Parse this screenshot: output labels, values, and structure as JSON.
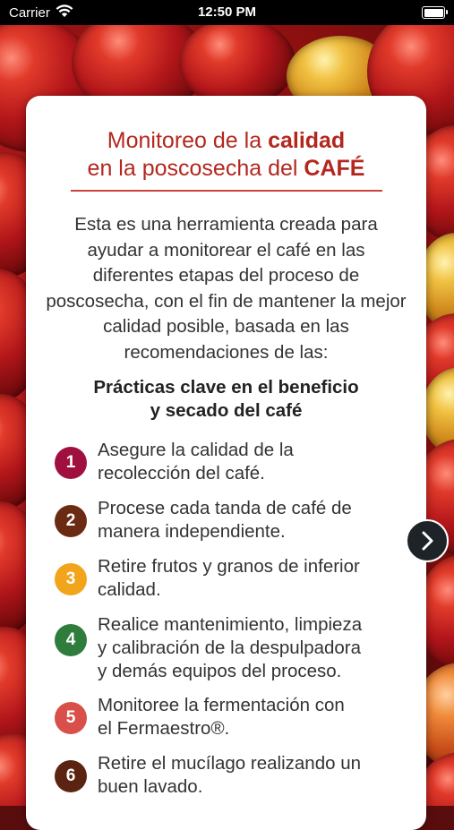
{
  "status_bar": {
    "carrier": "Carrier",
    "time": "12:50 PM",
    "wifi_icon": "wifi-icon",
    "battery_icon": "battery-icon"
  },
  "card": {
    "title_line1_regular": "Monitoreo de la ",
    "title_line1_bold": "calidad",
    "title_line2_regular": "en la poscosecha del ",
    "title_line2_bold": "CAFÉ",
    "intro": "Esta es una herramienta creada para ayudar a monitorear el café en las diferentes etapas del proceso de poscosecha, con el fin de mantener la mejor calidad posible, basada en las recomendaciones de las:",
    "practices_heading_line1": "Prácticas clave en el beneficio",
    "practices_heading_line2": "y secado del café",
    "items": [
      {
        "number": "1",
        "text_line1": "Asegure la calidad de la",
        "text_line2": "recolección del café.",
        "text_line3": "",
        "color": "#a0103f"
      },
      {
        "number": "2",
        "text_line1": "Procese cada tanda de café de",
        "text_line2": "manera independiente.",
        "text_line3": "",
        "color": "#6b2a12"
      },
      {
        "number": "3",
        "text_line1": "Retire frutos y granos de inferior",
        "text_line2": "calidad.",
        "text_line3": "",
        "color": "#f2a51a"
      },
      {
        "number": "4",
        "text_line1": "Realice mantenimiento, limpieza",
        "text_line2": "y calibración de la despulpadora",
        "text_line3": "y demás equipos del proceso.",
        "color": "#2e7d3c"
      },
      {
        "number": "5",
        "text_line1": "Monitoree la fermentación con",
        "text_line2": "el Fermaestro®.",
        "text_line3": "",
        "color": "#d9504a"
      },
      {
        "number": "6",
        "text_line1": "Retire el mucílago realizando un",
        "text_line2": "buen lavado.",
        "text_line3": "",
        "color": "#5a2410"
      }
    ]
  },
  "navigation": {
    "next_icon": "chevron-right-icon"
  },
  "colors": {
    "title": "#b3271e",
    "next_button": "#1e2327"
  }
}
